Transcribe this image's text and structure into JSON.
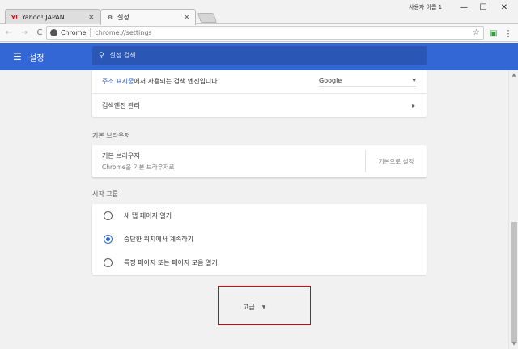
{
  "window": {
    "profile_name": "사용자 이름 1",
    "minimize": "—",
    "maximize": "☐",
    "close": "✕"
  },
  "tabs": [
    {
      "title": "Yahoo! JAPAN",
      "favicon": "y-logo-icon",
      "active": false
    },
    {
      "title": "설정",
      "favicon": "gear-icon",
      "active": true
    }
  ],
  "toolbar": {
    "back": "←",
    "forward": "→",
    "reload": "C",
    "secure_label": "Chrome",
    "url": "chrome://settings",
    "star": "☆"
  },
  "header": {
    "title": "설정",
    "search_placeholder": "설정 검색"
  },
  "search_engine": {
    "used_prefix_link": "주소 표시줄",
    "used_suffix": "에서 사용되는 검색 엔진입니다.",
    "selected_engine": "Google",
    "manage_label": "검색엔진 관리"
  },
  "default_browser": {
    "section_label": "기본 브라우저",
    "row_title": "기본 브라우저",
    "row_sub": "Chrome을 기본 브라우저로",
    "button": "기본으로 설정"
  },
  "startup": {
    "section_label": "시작 그룹",
    "options": [
      {
        "label": "새 탭 페이지 열기",
        "selected": false
      },
      {
        "label": "중단한 위치에서 계속하기",
        "selected": true
      },
      {
        "label": "특정 페이지 또는 페이지 모음 열기",
        "selected": false
      }
    ]
  },
  "advanced": {
    "label": "고급"
  },
  "colors": {
    "header_bg": "#3367d6",
    "accent": "#3367d6",
    "highlight_border": "#e00000"
  }
}
